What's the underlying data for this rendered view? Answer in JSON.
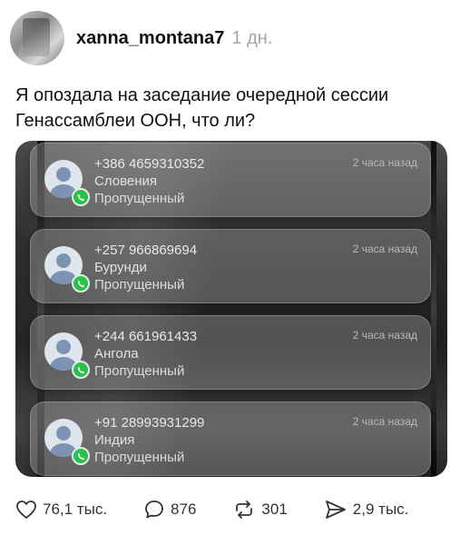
{
  "post": {
    "author": "xanna_montana7",
    "time_ago": "1 дн.",
    "text": "Я опоздала на заседание очередной сессии Генассамблеи ООН, что ли?"
  },
  "calls": [
    {
      "number": "+386 4659310352",
      "country": "Словения",
      "status": "Пропущенный",
      "ago": "2 часа назад"
    },
    {
      "number": "+257 966869694",
      "country": "Бурунди",
      "status": "Пропущенный",
      "ago": "2 часа назад"
    },
    {
      "number": "+244 661961433",
      "country": "Ангола",
      "status": "Пропущенный",
      "ago": "2 часа назад"
    },
    {
      "number": "+91 28993931299",
      "country": "Индия",
      "status": "Пропущенный",
      "ago": "2 часа назад"
    }
  ],
  "actions": {
    "likes": "76,1 тыс.",
    "replies": "876",
    "reposts": "301",
    "shares": "2,9 тыс."
  },
  "icons": {
    "like": "heart-icon",
    "reply": "speech-bubble-icon",
    "repost": "repost-arrows-icon",
    "share": "paper-plane-icon",
    "call": "phone-icon"
  },
  "colors": {
    "call_badge": "#28c24a",
    "avatar_figure": "#7d93b4"
  }
}
